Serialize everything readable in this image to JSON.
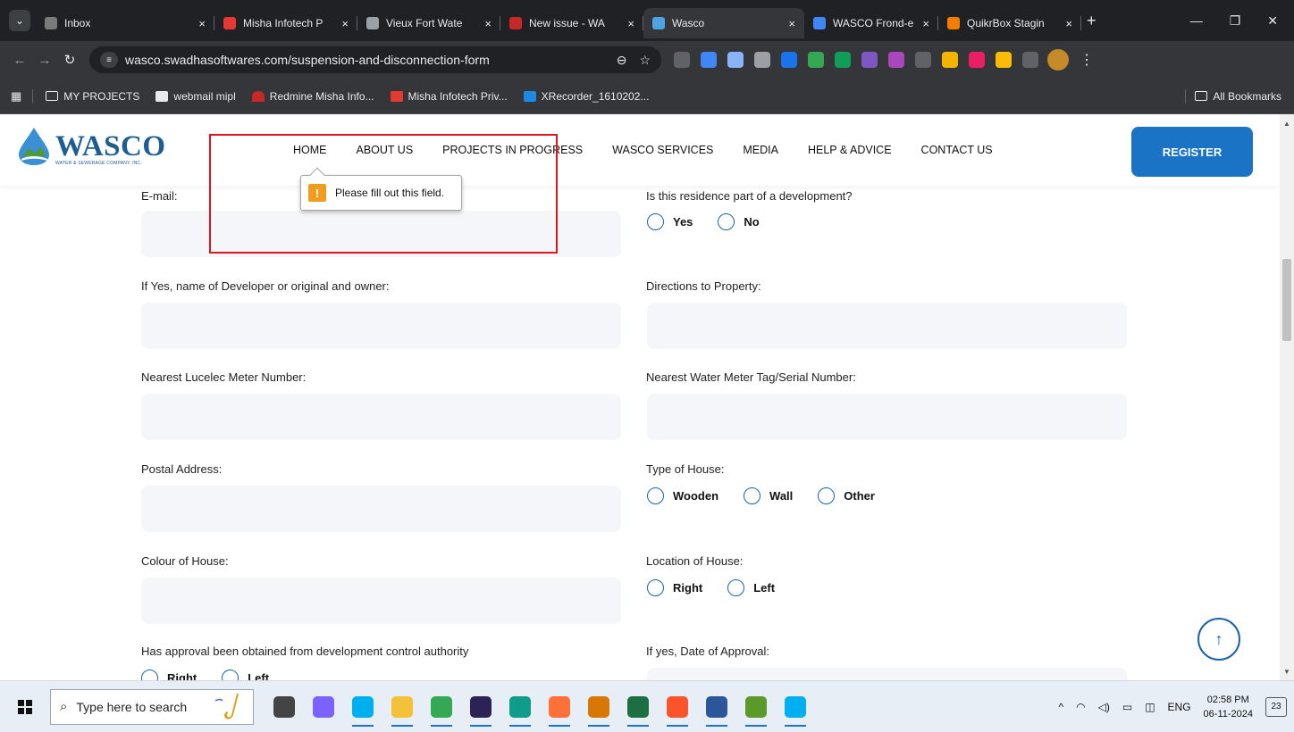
{
  "browser": {
    "tabs": [
      {
        "title": "Inbox",
        "fav": "#7a7a7a",
        "w": 200
      },
      {
        "title": "Misha Infotech P",
        "fav": "#e53935",
        "w": 160
      },
      {
        "title": "Vieux Fort Wate",
        "fav": "#9aa0a6",
        "w": 160
      },
      {
        "title": "New issue - WA",
        "fav": "#c62828",
        "w": 160
      },
      {
        "title": "Wasco",
        "fav": "#4fa3e0",
        "w": 180,
        "active": true
      },
      {
        "title": "WASCO Frond-e",
        "fav": "#4285f4",
        "w": 150
      },
      {
        "title": "QuikrBox Stagin",
        "fav": "#f57c00",
        "w": 160
      }
    ],
    "tab_close_glyph": "×",
    "new_tab_glyph": "+",
    "url": "wasco.swadhasoftwares.com/suspension-and-disconnection-form",
    "bookmarks": [
      "MY PROJECTS",
      "webmail mipl",
      "Redmine Misha Info...",
      "Misha Infotech Priv...",
      "XRecorder_1610202..."
    ],
    "all_bookmarks": "All Bookmarks",
    "extension_colors": [
      "#5f6368",
      "#4285f4",
      "#8ab4f8",
      "#9aa0a6",
      "#1a73e8",
      "#34a853",
      "#0f9d58",
      "#7e57c2",
      "#ab47bc",
      "#5f6368",
      "#f4b400",
      "#e91e63",
      "#fbbc05",
      "#5f6368"
    ]
  },
  "site": {
    "logo_word": "WASCO",
    "logo_sub": "WATER & SEWERAGE COMPANY, INC.",
    "menu": [
      "HOME",
      "ABOUT US",
      "PROJECTS IN PROGRESS",
      "WASCO SERVICES",
      "MEDIA",
      "HELP & ADVICE",
      "CONTACT US"
    ],
    "register": "REGISTER"
  },
  "tooltip": {
    "icon": "!",
    "text": "Please fill out this field."
  },
  "form": {
    "email": {
      "label": "E-mail:"
    },
    "development": {
      "label": "Is this residence part of a development?",
      "options": [
        "Yes",
        "No"
      ]
    },
    "developer": {
      "label": "If Yes, name of Developer or original and owner:"
    },
    "directions": {
      "label": "Directions to Property:"
    },
    "lucelec": {
      "label": "Nearest Lucelec Meter Number:"
    },
    "water_meter": {
      "label": "Nearest Water Meter Tag/Serial Number:"
    },
    "postal": {
      "label": "Postal Address:"
    },
    "house_type": {
      "label": "Type of House:",
      "options": [
        "Wooden",
        "Wall",
        "Other"
      ]
    },
    "colour": {
      "label": "Colour of House:"
    },
    "location": {
      "label": "Location of House:",
      "options": [
        "Right",
        "Left"
      ]
    },
    "approval": {
      "label": "Has approval been obtained from development control authority",
      "options": [
        "Right",
        "Left"
      ]
    },
    "approval_date": {
      "label": "If yes, Date of Approval:"
    }
  },
  "taskbar": {
    "search_placeholder": "Type here to search",
    "apps": [
      {
        "name": "task-view",
        "color": "#444"
      },
      {
        "name": "copilot",
        "color": "#7b61ff"
      },
      {
        "name": "skype",
        "color": "#00aff0"
      },
      {
        "name": "file-explorer",
        "color": "#f3c13a"
      },
      {
        "name": "chrome",
        "color": "#34a853"
      },
      {
        "name": "eclipse",
        "color": "#2c2255"
      },
      {
        "name": "edge",
        "color": "#0f9d8a"
      },
      {
        "name": "firefox",
        "color": "#ff7139"
      },
      {
        "name": "chrome-canary",
        "color": "#d97706"
      },
      {
        "name": "excel-like",
        "color": "#1d6f42"
      },
      {
        "name": "brave",
        "color": "#fb542b"
      },
      {
        "name": "word",
        "color": "#2b579a"
      },
      {
        "name": "chart-app",
        "color": "#5a9a2a"
      },
      {
        "name": "skype-2",
        "color": "#00aff0"
      }
    ],
    "tray_chevron": "^",
    "lang": "ENG",
    "time": "02:58 PM",
    "date": "06-11-2024",
    "notifications": "23"
  }
}
